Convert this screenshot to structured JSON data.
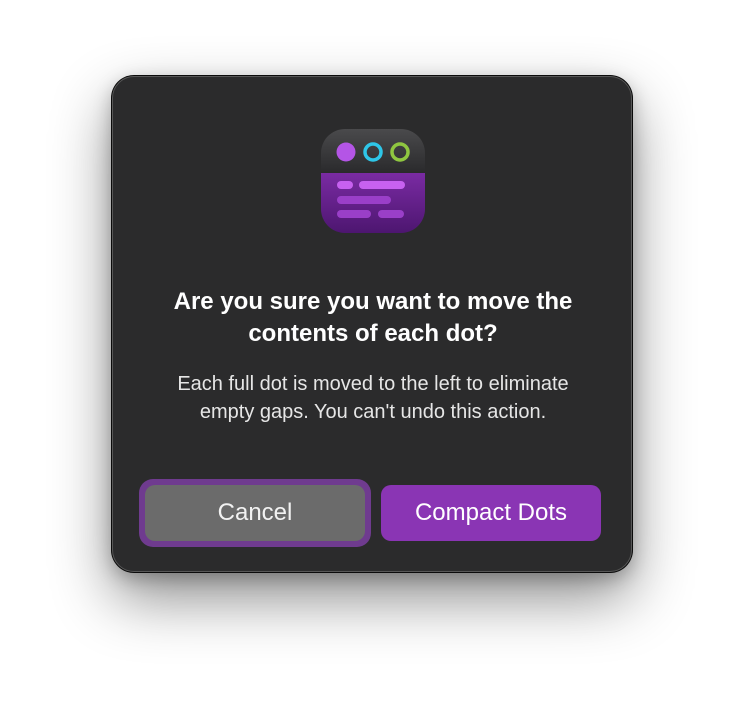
{
  "dialog": {
    "app_icon": "compact-dots-app-icon",
    "title": "Are you sure you want to move the contents of each dot?",
    "message": "Each full dot is moved to the left to eliminate empty gaps. You can't undo this action.",
    "cancel_label": "Cancel",
    "confirm_label": "Compact Dots"
  },
  "colors": {
    "dialog_background": "#2b2b2c",
    "accent_purple": "#8a35b4",
    "cancel_button": "#6b6b6b",
    "focus_ring": "#6f3b8f",
    "icon_dot_filled": "#b455e6",
    "icon_ring_cyan": "#2ec6e8",
    "icon_ring_green": "#8fc640"
  }
}
